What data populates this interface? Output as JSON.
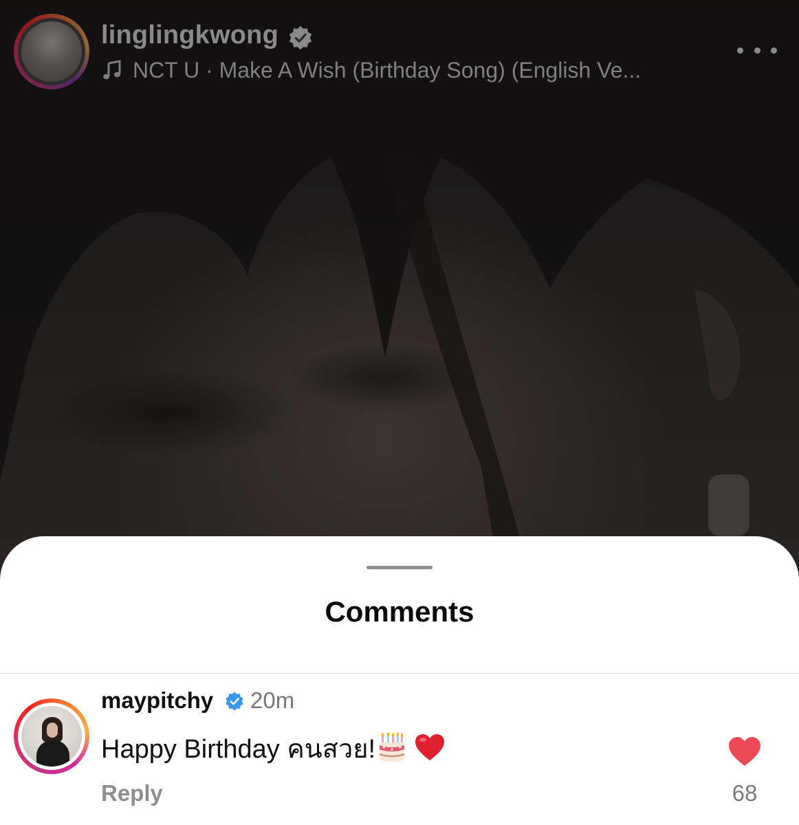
{
  "story": {
    "username": "linglingkwong",
    "music": "NCT U · Make A Wish (Birthday Song) (English Ve..."
  },
  "icons": {
    "verified": "verified-badge-icon",
    "music": "music-note-icon",
    "more": "more-options-icon",
    "like": "heart-icon",
    "emoji": [
      "birthday-cake-emoji",
      "red-heart-emoji"
    ]
  },
  "sheet": {
    "title": "Comments"
  },
  "comments": [
    {
      "username": "maypitchy",
      "time": "20m",
      "text": "Happy Birthday คนสวย!",
      "reply_label": "Reply",
      "like_count": "68",
      "liked": true
    }
  ],
  "colors": {
    "like_red": "#ed4956",
    "verified_blue": "#3897f0",
    "sheet_bg": "#ffffff"
  }
}
